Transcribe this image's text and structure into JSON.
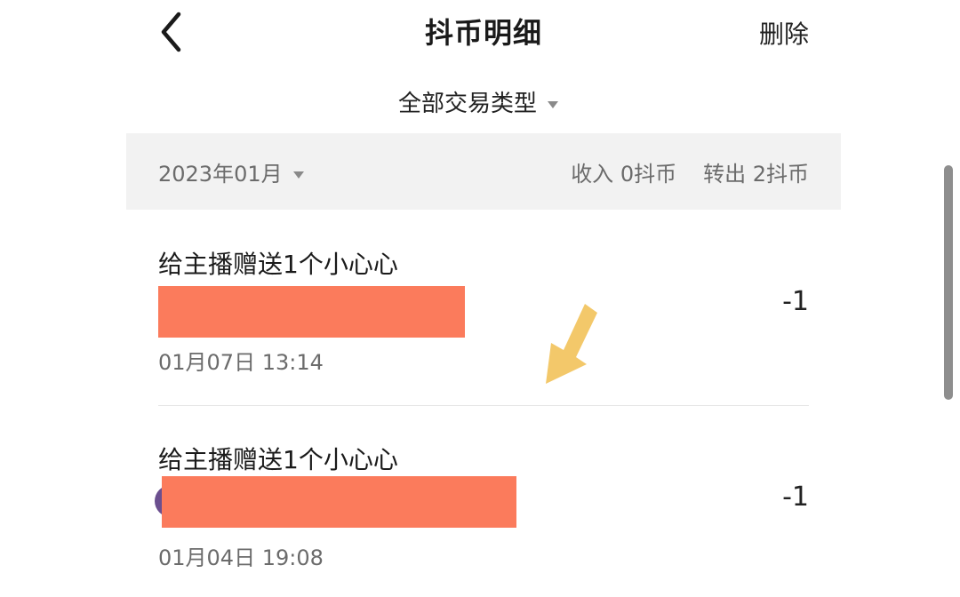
{
  "header": {
    "title": "抖币明细",
    "delete_label": "删除"
  },
  "filter": {
    "type_label": "全部交易类型"
  },
  "summary": {
    "month": "2023年01月",
    "income": "收入 0抖币",
    "outgo": "转出 2抖币"
  },
  "records": [
    {
      "title": "给主播赠送1个小心心",
      "time": "01月07日 13:14",
      "amount": "-1"
    },
    {
      "title": "给主播赠送1个小心心",
      "time": "01月04日 19:08",
      "amount": "-1"
    }
  ],
  "colors": {
    "redaction": "#fb7b5c",
    "annotation_arrow": "#f3c86a",
    "summary_bg": "#f2f2f2"
  },
  "icons": {
    "back": "chevron-left-icon",
    "dropdown": "caret-down-icon",
    "annotation": "arrow-down-left-icon"
  }
}
